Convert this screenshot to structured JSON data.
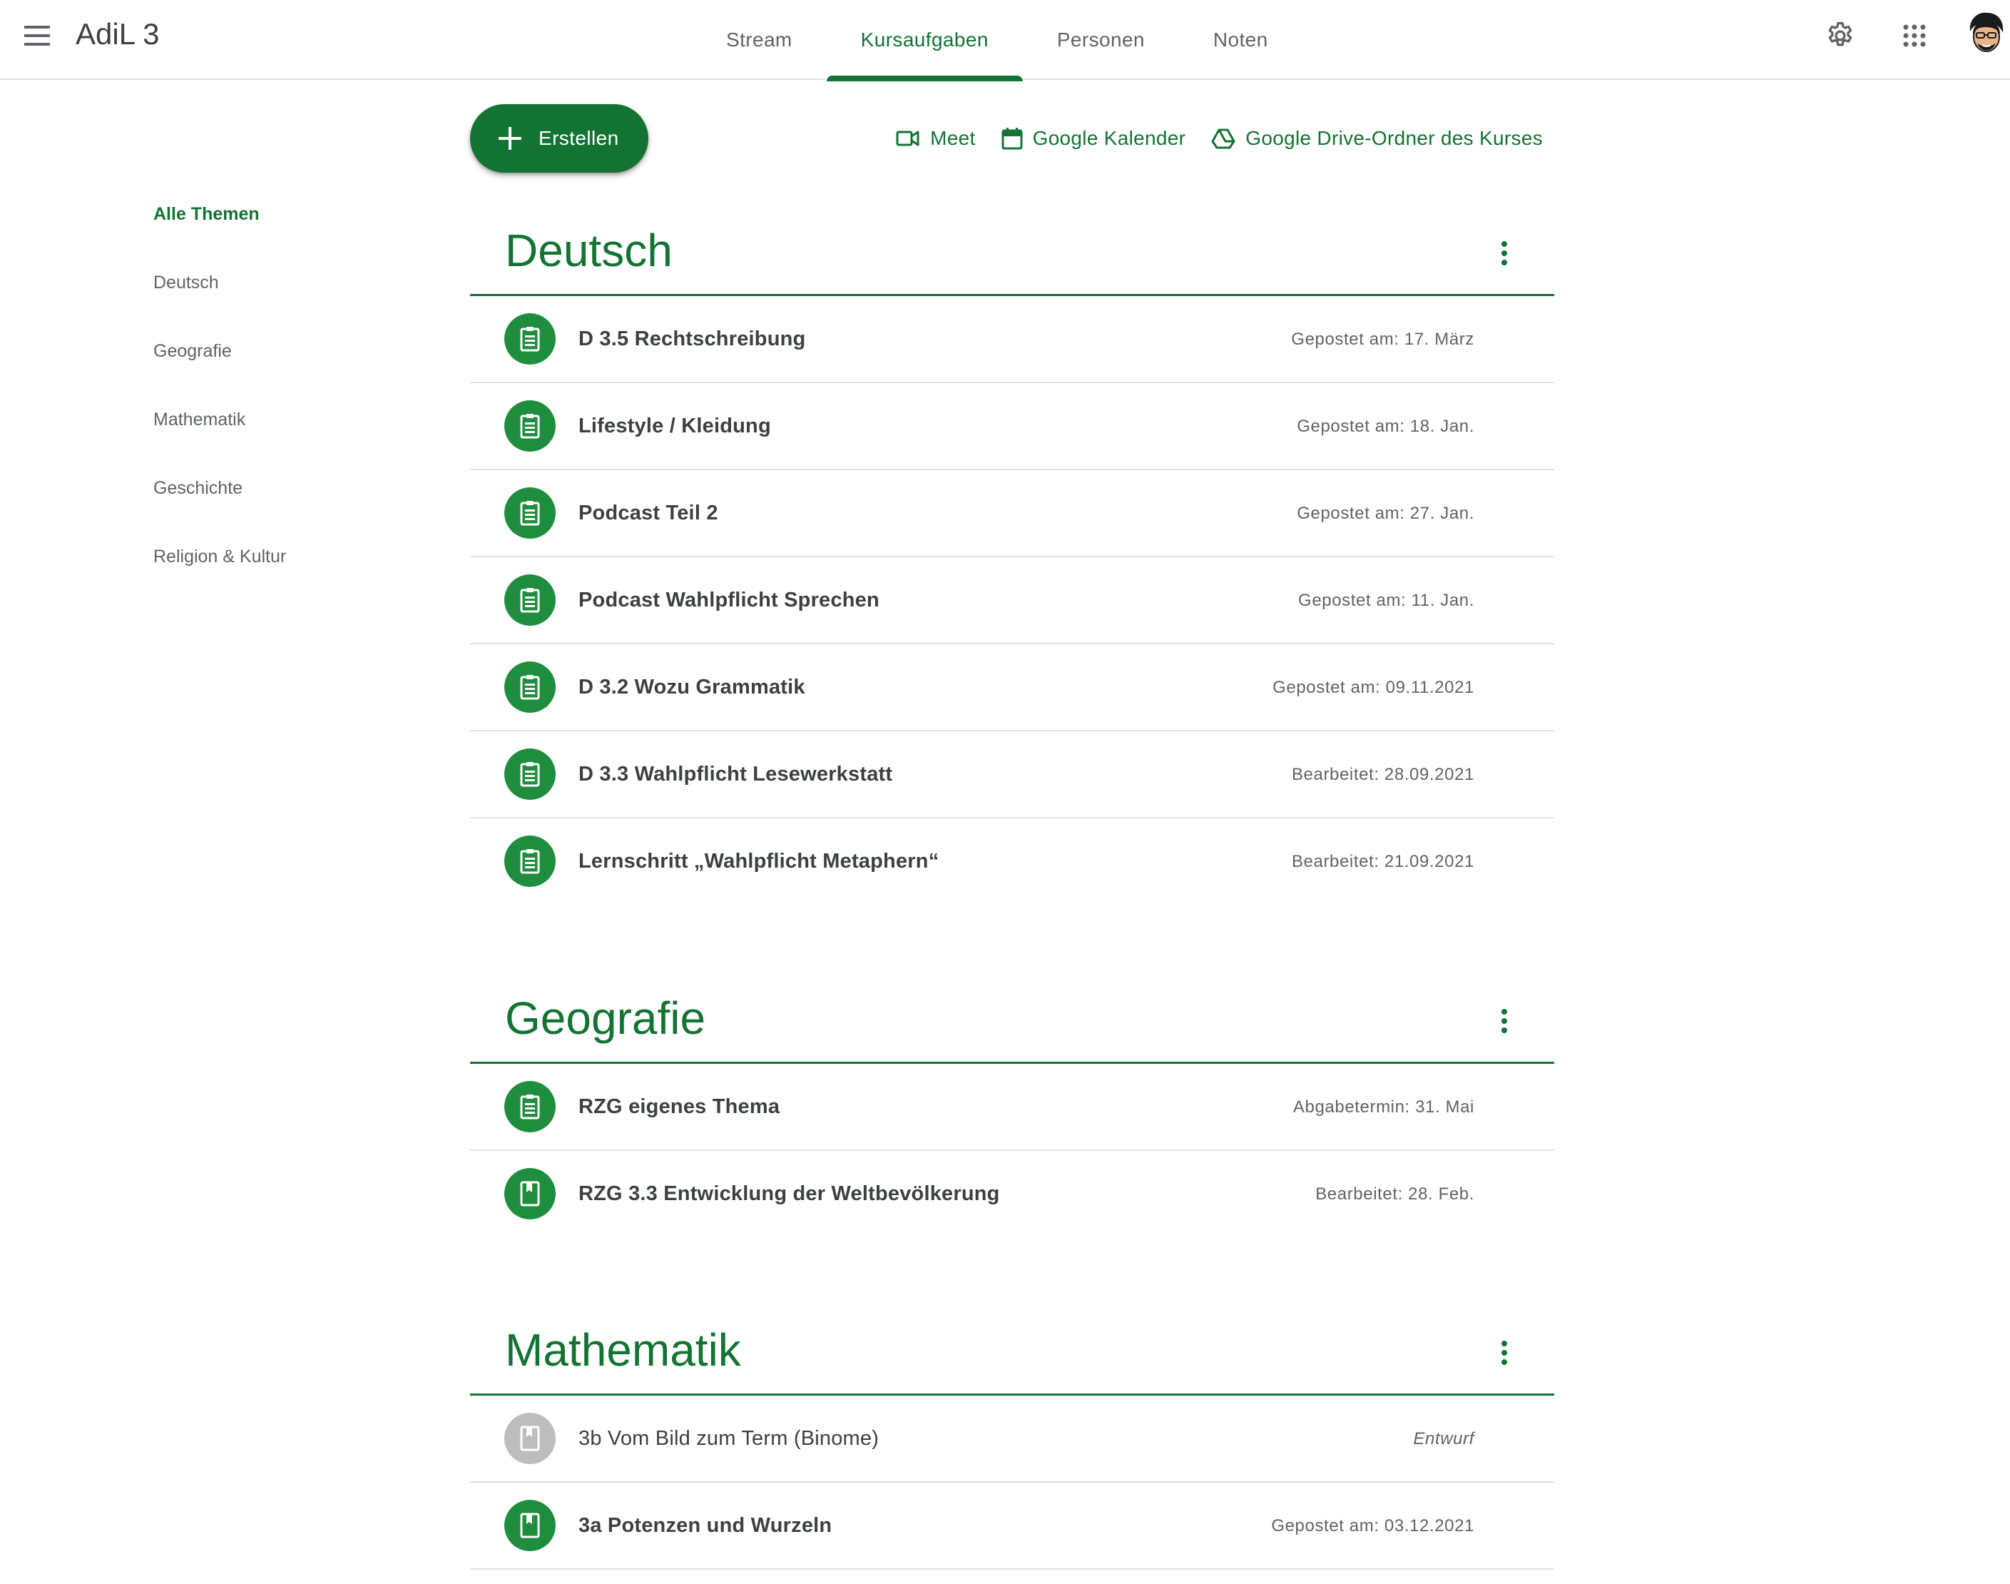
{
  "header": {
    "title": "AdiL 3",
    "tabs": [
      {
        "label": "Stream",
        "active": false
      },
      {
        "label": "Kursaufgaben",
        "active": true
      },
      {
        "label": "Personen",
        "active": false
      },
      {
        "label": "Noten",
        "active": false
      }
    ],
    "icons": [
      "menu-icon",
      "settings-gear-icon",
      "apps-grid-icon",
      "avatar"
    ]
  },
  "theme": {
    "accent": "#137333",
    "icon_bg": "#1e8e3e",
    "draft_bg": "#bdbdbd"
  },
  "sidebar": {
    "items": [
      {
        "label": "Alle Themen",
        "active": true
      },
      {
        "label": "Deutsch"
      },
      {
        "label": "Geografie"
      },
      {
        "label": "Mathematik"
      },
      {
        "label": "Geschichte"
      },
      {
        "label": "Religion & Kultur"
      }
    ]
  },
  "actions": {
    "create_label": "Erstellen",
    "links": [
      {
        "label": "Meet",
        "icon": "video-camera-icon"
      },
      {
        "label": "Google Kalender",
        "icon": "calendar-icon"
      },
      {
        "label": "Google Drive-Ordner des Kurses",
        "icon": "drive-icon"
      }
    ]
  },
  "sections": [
    {
      "title": "Deutsch",
      "items": [
        {
          "title": "D 3.5 Rechtschreibung",
          "meta": "Gepostet am: 17. März",
          "icon": "assignment-icon"
        },
        {
          "title": "Lifestyle / Kleidung",
          "meta": "Gepostet am: 18. Jan.",
          "icon": "assignment-icon"
        },
        {
          "title": "Podcast Teil 2",
          "meta": "Gepostet am: 27. Jan.",
          "icon": "assignment-icon"
        },
        {
          "title": "Podcast Wahlpflicht Sprechen",
          "meta": "Gepostet am: 11. Jan.",
          "icon": "assignment-icon"
        },
        {
          "title": "D 3.2 Wozu Grammatik",
          "meta": "Gepostet am: 09.11.2021",
          "icon": "assignment-icon"
        },
        {
          "title": "D 3.3 Wahlpflicht Lesewerkstatt",
          "meta": "Bearbeitet: 28.09.2021",
          "icon": "assignment-icon"
        },
        {
          "title": "Lernschritt „Wahlpflicht Metaphern“",
          "meta": "Bearbeitet: 21.09.2021",
          "icon": "assignment-icon"
        }
      ]
    },
    {
      "title": "Geografie",
      "items": [
        {
          "title": "RZG eigenes Thema",
          "meta": "Abgabetermin: 31. Mai",
          "icon": "assignment-icon"
        },
        {
          "title": "RZG 3.3 Entwicklung der Weltbevölkerung",
          "meta": "Bearbeitet: 28. Feb.",
          "icon": "material-icon"
        }
      ]
    },
    {
      "title": "Mathematik",
      "items": [
        {
          "title": "3b Vom Bild zum Term (Binome)",
          "meta": "Entwurf",
          "icon": "material-icon",
          "draft": true
        },
        {
          "title": "3a Potenzen und Wurzeln",
          "meta": "Gepostet am: 03.12.2021",
          "icon": "material-icon"
        }
      ]
    }
  ]
}
